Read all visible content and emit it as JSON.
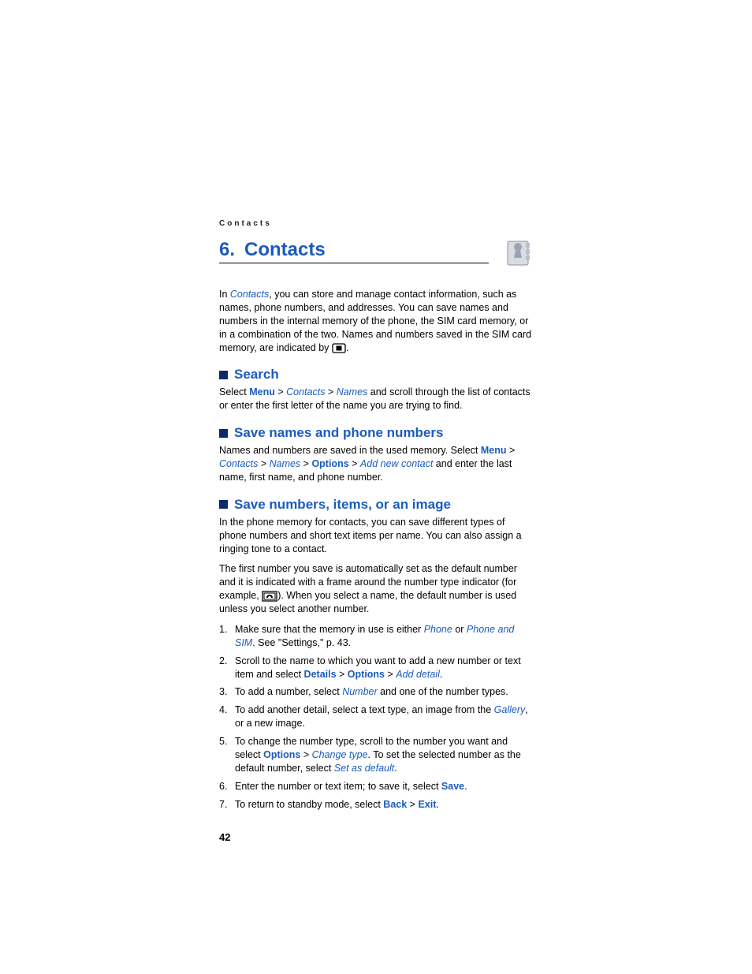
{
  "runningHeader": "Contacts",
  "chapter": {
    "number": "6.",
    "title": "Contacts"
  },
  "intro": {
    "pre": "In ",
    "contacts": "Contacts",
    "post": ", you can store and manage contact information, such as names, phone numbers, and addresses. You can save names and numbers in the internal memory of the phone, the SIM card memory, or in a combination of the two. Names and numbers saved in the SIM card memory, are indicated by ",
    "end": "."
  },
  "search": {
    "heading": "Search",
    "t1": "Select ",
    "menu": "Menu",
    "contacts": "Contacts",
    "names": "Names",
    "t2": " and scroll through the list of contacts or enter the first letter of the name you are trying to find."
  },
  "saveNames": {
    "heading": "Save names and phone numbers",
    "t1": "Names and numbers are saved in the used memory. Select ",
    "menu": "Menu",
    "contacts": "Contacts",
    "names": "Names",
    "options": "Options",
    "addNew": "Add new contact",
    "t2": " and enter the last name, first name, and phone number."
  },
  "saveNumbers": {
    "heading": "Save numbers, items, or an image",
    "p1": "In the phone memory for contacts, you can save different types of phone numbers and short text items per name. You can also assign a ringing tone to a contact.",
    "p2a": "The first number you save is automatically set as the default number and it is indicated with a frame around the number type indicator (for example, ",
    "p2b": "). When you select a name, the default number is used unless you select another number."
  },
  "steps": {
    "s1a": "Make sure that the memory in use is either ",
    "s1phone": "Phone",
    "s1or": " or ",
    "s1phoneSim": "Phone and SIM",
    "s1b": ". See \"Settings,\" p. 43.",
    "s2a": "Scroll to the name to which you want to add a new number or text item and select ",
    "s2details": "Details",
    "s2options": "Options",
    "s2add": "Add detail",
    "s2b": ".",
    "s3a": "To add a number, select ",
    "s3number": "Number",
    "s3b": " and one of the number types.",
    "s4a": "To add another detail, select a text type, an image from the ",
    "s4gallery": "Gallery",
    "s4b": ", or a new image.",
    "s5a": "To change the number type, scroll to the number you want and select ",
    "s5options": "Options",
    "s5change": "Change type",
    "s5b": ". To set the selected number as the default number, select ",
    "s5set": "Set as default",
    "s5c": ".",
    "s6a": "Enter the number or text item; to save it, select ",
    "s6save": "Save",
    "s6b": ".",
    "s7a": "To return to standby mode, select ",
    "s7back": "Back",
    "s7exit": "Exit",
    "s7b": "."
  },
  "gt": " > ",
  "pageNumber": "42"
}
